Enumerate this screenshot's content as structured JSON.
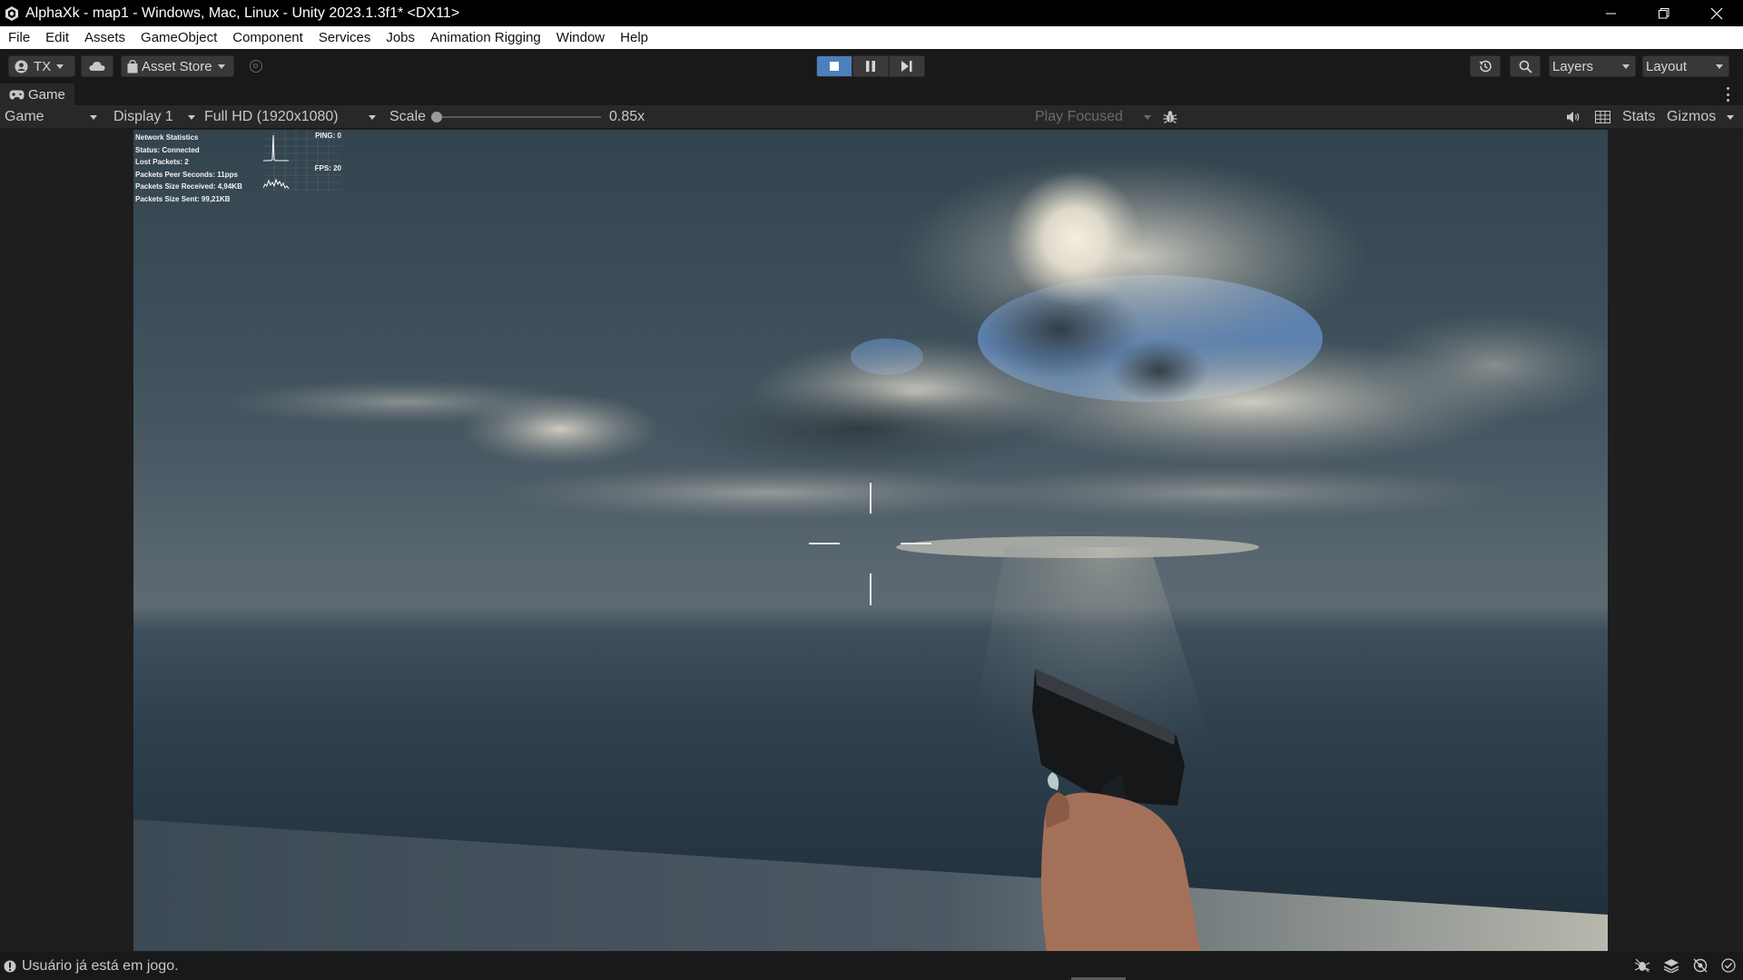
{
  "window": {
    "title": "AlphaXk - map1 - Windows, Mac, Linux - Unity 2023.1.3f1* <DX11>"
  },
  "menu": [
    "File",
    "Edit",
    "Assets",
    "GameObject",
    "Component",
    "Services",
    "Jobs",
    "Animation Rigging",
    "Window",
    "Help"
  ],
  "toolbar": {
    "account_label": "TX",
    "asset_store_label": "Asset Store",
    "layers_label": "Layers",
    "layout_label": "Layout",
    "play_state": "playing",
    "accent_color": "#4d7fbd"
  },
  "game_tab": {
    "label": "Game"
  },
  "game_toolbar": {
    "view_select": "Game",
    "display_select": "Display 1",
    "resolution_select": "Full HD (1920x1080)",
    "scale_label": "Scale",
    "scale_value": "0.85x",
    "scale_fraction": 0.0,
    "play_mode_select": "Play Focused",
    "stats_label": "Stats",
    "gizmos_label": "Gizmos"
  },
  "network_stats": {
    "title": "Network Statistics",
    "status": "Status: Connected",
    "lost_packets": "Lost Packets: 2",
    "packets_per_second": "Packets Peer Seconds: 11pps",
    "size_received": "Packets Size Received: 4,94KB",
    "size_sent": "Packets Size Sent: 99,21KB",
    "ping_label": "PING: 0",
    "fps_label": "FPS: 20"
  },
  "status_bar": {
    "message": "Usuário já está em jogo."
  }
}
